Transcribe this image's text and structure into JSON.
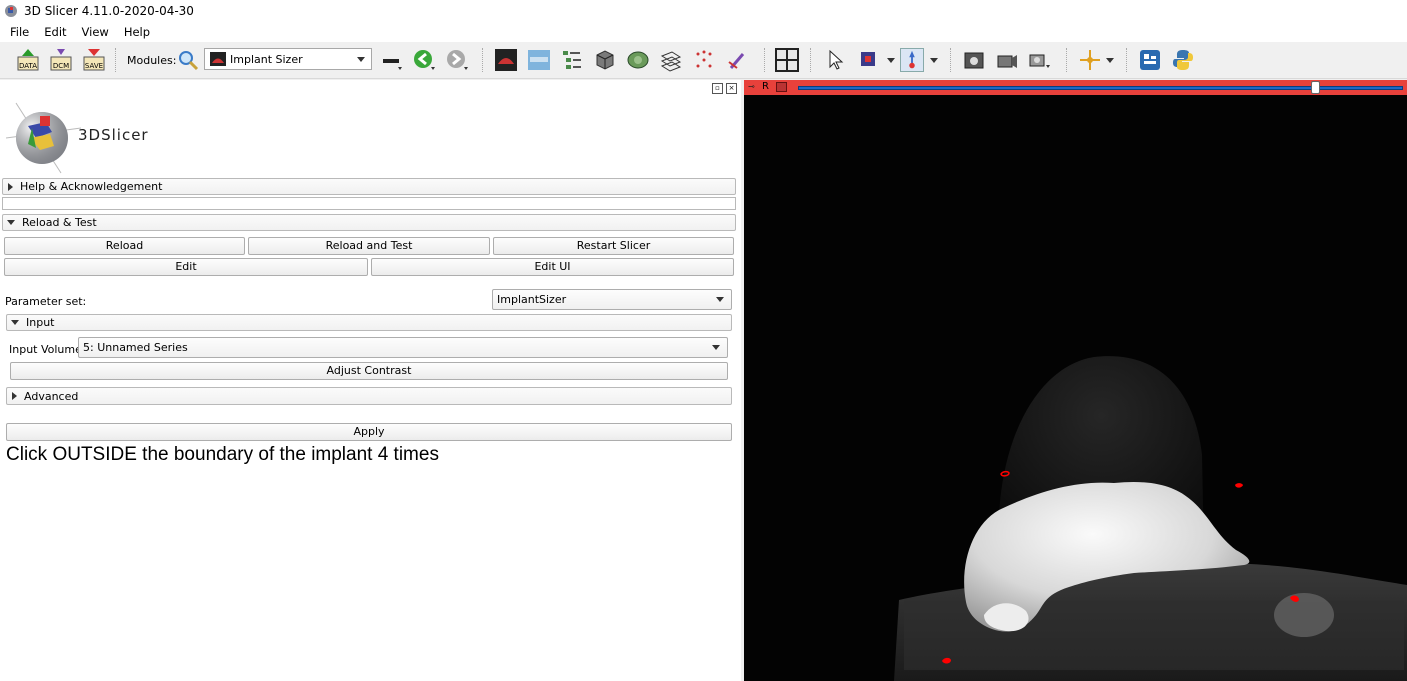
{
  "window": {
    "title": "3D Slicer 4.11.0-2020-04-30"
  },
  "menu": [
    {
      "label": "File"
    },
    {
      "label": "Edit"
    },
    {
      "label": "View"
    },
    {
      "label": "Help"
    }
  ],
  "toolbar": {
    "data_label": "DATA",
    "dcm_label": "DCM",
    "save_label": "SAVE",
    "modules_label": "Modules:",
    "module_selected": "Implant Sizer"
  },
  "panel": {
    "logo_text": "3DSlicer",
    "help_section": "Help & Acknowledgement",
    "reload_section": "Reload & Test",
    "reload_btn": "Reload",
    "reload_test_btn": "Reload and Test",
    "restart_btn": "Restart Slicer",
    "edit_btn": "Edit",
    "edit_ui_btn": "Edit UI",
    "parameter_label": "Parameter set:",
    "parameter_value": "ImplantSizer",
    "input_section": "Input",
    "input_volume_label": "Input Volume:",
    "input_volume_value": "5: Unnamed Series",
    "adjust_contrast_btn": "Adjust Contrast",
    "advanced_section": "Advanced",
    "apply_btn": "Apply",
    "instruction": "Click OUTSIDE the boundary of the implant 4 times"
  },
  "view": {
    "name": "R",
    "bar_color": "#e8413b",
    "slider_value": 0.86
  },
  "colors": {
    "slider_accent": "#1e68c7",
    "marker": "#ff0000"
  }
}
